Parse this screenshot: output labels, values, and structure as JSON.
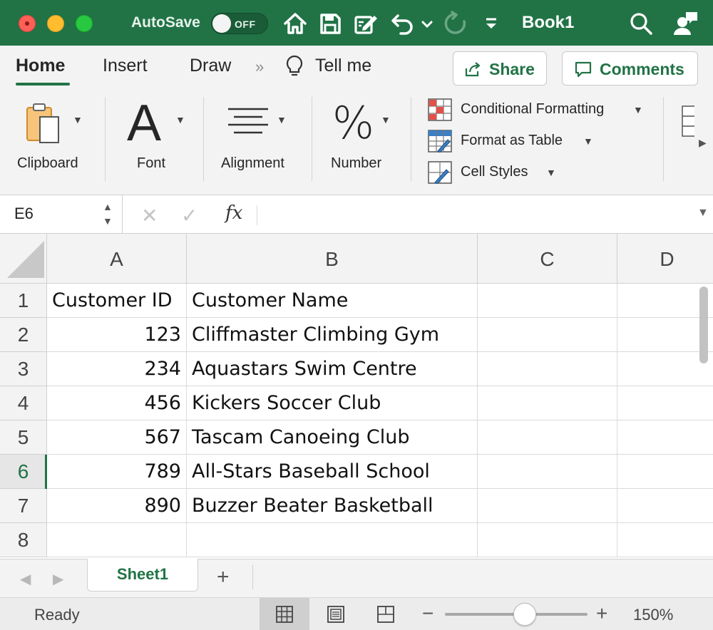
{
  "colors": {
    "accent": "#217346",
    "title_bar": "#217346",
    "close": "#fe5f57",
    "minimize": "#febc2e",
    "zoom": "#28c840"
  },
  "title_bar": {
    "autosave_label": "AutoSave",
    "autosave_state": "OFF",
    "document_title": "Book1",
    "icons": [
      "home-icon",
      "save-icon",
      "edit-icon",
      "undo-icon",
      "redo-icon",
      "customize-icon",
      "search-icon",
      "share-person-icon"
    ]
  },
  "ribbon_tabs": {
    "items": [
      "Home",
      "Insert",
      "Draw"
    ],
    "active": "Home",
    "tell_me": "Tell me",
    "share_label": "Share",
    "comments_label": "Comments"
  },
  "ribbon": {
    "clipboard": "Clipboard",
    "font_glyph": "A",
    "font": "Font",
    "alignment": "Alignment",
    "number_glyph": "%",
    "number": "Number",
    "conditional_formatting": "Conditional Formatting",
    "format_as_table": "Format as Table",
    "cell_styles": "Cell Styles"
  },
  "formula_bar": {
    "name_box": "E6",
    "fx": "fx",
    "formula": ""
  },
  "sheet": {
    "columns": [
      "A",
      "B",
      "C",
      "D"
    ],
    "rows": [
      "1",
      "2",
      "3",
      "4",
      "5",
      "6",
      "7",
      "8"
    ],
    "active_cell": "E6",
    "headers": [
      "Customer ID",
      "Customer Name"
    ],
    "data": [
      [
        "123",
        "Cliffmaster Climbing Gym"
      ],
      [
        "234",
        "Aquastars Swim Centre"
      ],
      [
        "456",
        "Kickers Soccer Club"
      ],
      [
        "567",
        "Tascam Canoeing Club"
      ],
      [
        "789",
        "All-Stars Baseball School"
      ],
      [
        "890",
        "Buzzer Beater Basketball"
      ]
    ]
  },
  "sheet_tabs": {
    "active": "Sheet1",
    "add": "+"
  },
  "status_bar": {
    "status": "Ready",
    "zoom": "150%",
    "zoom_fraction": 0.56,
    "view_mode": "normal"
  }
}
